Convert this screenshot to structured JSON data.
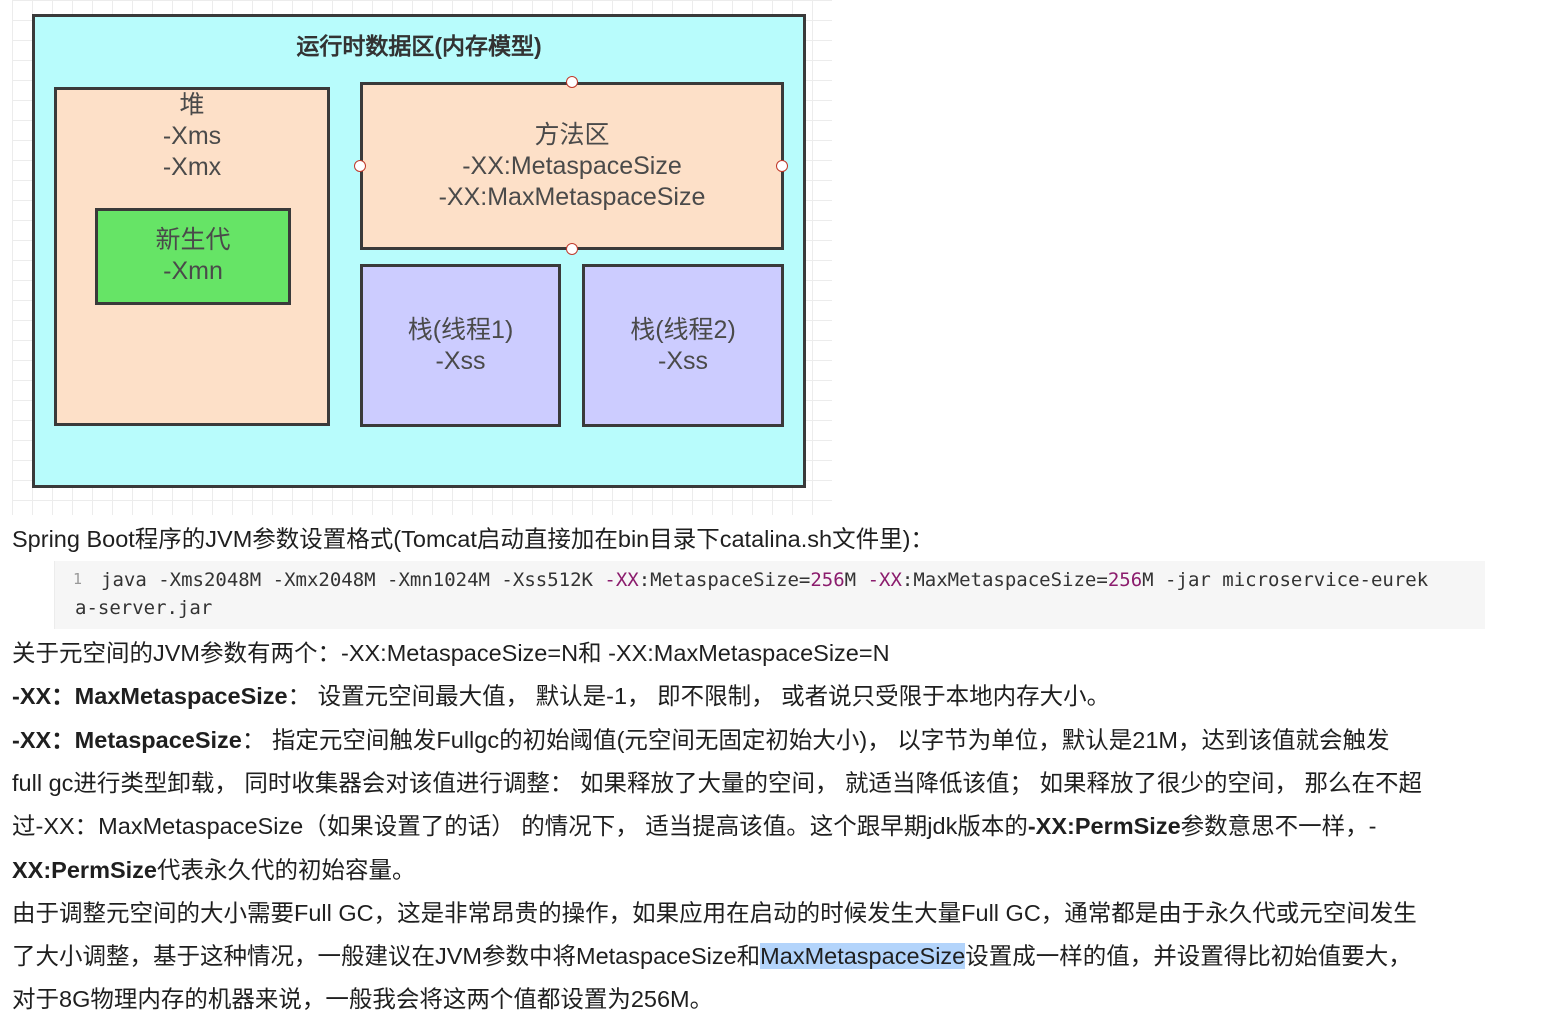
{
  "diagram": {
    "title": "运行时数据区(内存模型)",
    "heap": {
      "name": "堆",
      "params": [
        "-Xms",
        "-Xmx"
      ]
    },
    "young": {
      "name": "新生代",
      "param": "-Xmn"
    },
    "method_area": {
      "name": "方法区",
      "params": [
        "-XX:MetaspaceSize",
        "-XX:MaxMetaspaceSize"
      ]
    },
    "stack1": {
      "name": "栈(线程1)",
      "param": "-Xss"
    },
    "stack2": {
      "name": "栈(线程2)",
      "param": "-Xss"
    }
  },
  "intro": "Spring Boot程序的JVM参数设置格式(Tomcat启动直接加在bin目录下catalina.sh文件里)：",
  "code": {
    "line_number": "1",
    "tokens": {
      "t1": "java ",
      "t2": "-",
      "t3": "Xms2048M ",
      "t4": "-",
      "t5": "Xmx2048M ",
      "t6": "-",
      "t7": "Xmn1024M ",
      "t8": "-",
      "t9": "Xss512K ",
      "t10": "-XX",
      "t11": ":",
      "t12": "MetaspaceSize",
      "t13": "=",
      "t14": "256",
      "t15": "M ",
      "t16": "-XX",
      "t17": ":",
      "t18": "MaxMetaspaceSize",
      "t19": "=",
      "t20": "256",
      "t21": "M ",
      "t22": "-",
      "t23": "jar microservice",
      "t24": "-",
      "t25": "eurek",
      "w1": "a",
      "w2": "-",
      "w3": "server.jar"
    }
  },
  "p1": "关于元空间的JVM参数有两个：-XX:MetaspaceSize=N和 -XX:MaxMetaspaceSize=N",
  "p2": {
    "bold": "-XX：MaxMetaspaceSize",
    "text": "： 设置元空间最大值， 默认是-1， 即不限制， 或者说只受限于本地内存大小。"
  },
  "p3": {
    "bold1": "-XX：MetaspaceSize",
    "line1": "： 指定元空间触发Fullgc的初始阈值(元空间无固定初始大小)， 以字节为单位，默认是21M，达到该值就会触发",
    "line2": "full gc进行类型卸载， 同时收集器会对该值进行调整： 如果释放了大量的空间， 就适当降低该值； 如果释放了很少的空间， 那么在不超",
    "line3a": "过-XX：MaxMetaspaceSize（如果设置了的话） 的情况下， 适当提高该值。这个跟早期jdk版本的",
    "bold2": "-XX:PermSize",
    "line3b": "参数意思不一样，-",
    "bold3": "XX:PermSize",
    "line4": "代表永久代的初始容量。"
  },
  "p4": {
    "line1": "由于调整元空间的大小需要Full GC，这是非常昂贵的操作，如果应用在启动的时候发生大量Full GC，通常都是由于永久代或元空间发生",
    "line2a": "了大小调整，基于这种情况，一般建议在JVM参数中将MetaspaceSize和",
    "highlight": "MaxMetaspaceSize",
    "line2b": "设置成一样的值，并设置得比初始值要大，",
    "line3": "对于8G物理内存的机器来说，一般我会将这两个值都设置为256M。"
  }
}
